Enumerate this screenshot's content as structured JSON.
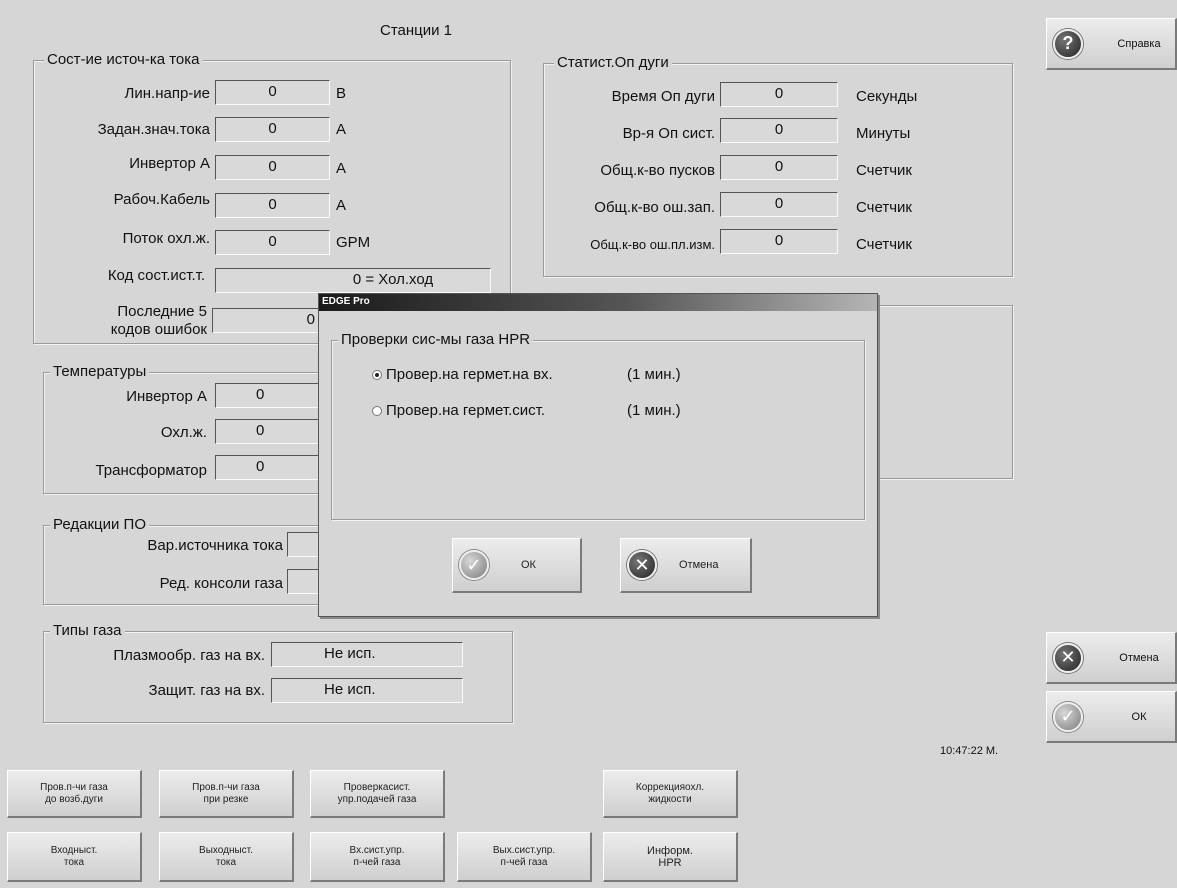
{
  "page_title": "Станции 1",
  "help_button": "Справка",
  "source": {
    "legend": "Сост-ие источ-ка тока",
    "rows": [
      {
        "label": "Лин.напр-ие",
        "value": "0",
        "unit": "В"
      },
      {
        "label": "Задан.знач.тока",
        "value": "0",
        "unit": "А"
      },
      {
        "label": "Инвертор А",
        "value": "0",
        "unit": "А"
      },
      {
        "label": "Рабоч.Кабель",
        "value": "0",
        "unit": "А"
      },
      {
        "label": "Поток охл.ж.",
        "value": "0",
        "unit": "GPM"
      }
    ],
    "state_label": "Код сост.ист.т.",
    "state_value": "0 = Хол.ход",
    "errors_label_1": "Последние 5",
    "errors_label_2": "кодов ошибок",
    "errors_value": "0"
  },
  "stats": {
    "legend": "Статист.Оп дуги",
    "rows": [
      {
        "label": "Время Оп дуги",
        "value": "0",
        "unit": "Секунды"
      },
      {
        "label": "Вр-я Оп сист.",
        "value": "0",
        "unit": "Минуты"
      },
      {
        "label": "Общ.к-во пусков",
        "value": "0",
        "unit": "Счетчик"
      },
      {
        "label": "Общ.к-во ош.зап.",
        "value": "0",
        "unit": "Счетчик"
      },
      {
        "label": "Общ.к-во ош.пл.изм.",
        "value": "0",
        "unit": "Счетчик"
      }
    ]
  },
  "temps": {
    "legend": "Температуры",
    "rows": [
      {
        "label": "Инвертор А",
        "value": "0"
      },
      {
        "label": "Охл.ж.",
        "value": "0"
      },
      {
        "label": "Трансформатор",
        "value": "0"
      }
    ]
  },
  "fw": {
    "legend": "Редакции ПО",
    "rows": [
      {
        "label": "Вар.источника тока"
      },
      {
        "label": "Ред. консоли газа"
      }
    ]
  },
  "gas": {
    "legend": "Типы газа",
    "rows": [
      {
        "label": "Плазмообр. газ на вх.",
        "value": "Не исп."
      },
      {
        "label": "Защит. газ на вх.",
        "value": "Не исп."
      }
    ]
  },
  "dialog": {
    "title": "EDGE Pro",
    "group_legend": "Проверки сис-мы газа HPR",
    "options": [
      {
        "label": "Провер.на гермет.на вх.",
        "duration": "(1 мин.)",
        "selected": true
      },
      {
        "label": "Провер.на гермет.сист.",
        "duration": "(1 мин.)",
        "selected": false
      }
    ],
    "ok": "ОК",
    "cancel": "Отмена"
  },
  "side": {
    "cancel": "Отмена",
    "ok": "ОК"
  },
  "clock": "10:47:22 М.",
  "bottom_row1": [
    {
      "l1": "Пров.п-чи газа",
      "l2": "до возб.дуги"
    },
    {
      "l1": "Пров.п-чи газа",
      "l2": "при резке"
    },
    {
      "l1": "Проверкасист.",
      "l2": "упр.подачей газа"
    },
    {
      "l1": "Коррекцияохл.",
      "l2": "жидкости"
    }
  ],
  "bottom_row2": [
    {
      "l1": "Входныст.",
      "l2": "тока"
    },
    {
      "l1": "Выходныст.",
      "l2": "тока"
    },
    {
      "l1": "Вх.сист.упр.",
      "l2": "п-чей газа"
    },
    {
      "l1": "Вых.сист.упр.",
      "l2": "п-чей газа"
    },
    {
      "l1": "Информ.",
      "l2": "HPR"
    }
  ]
}
